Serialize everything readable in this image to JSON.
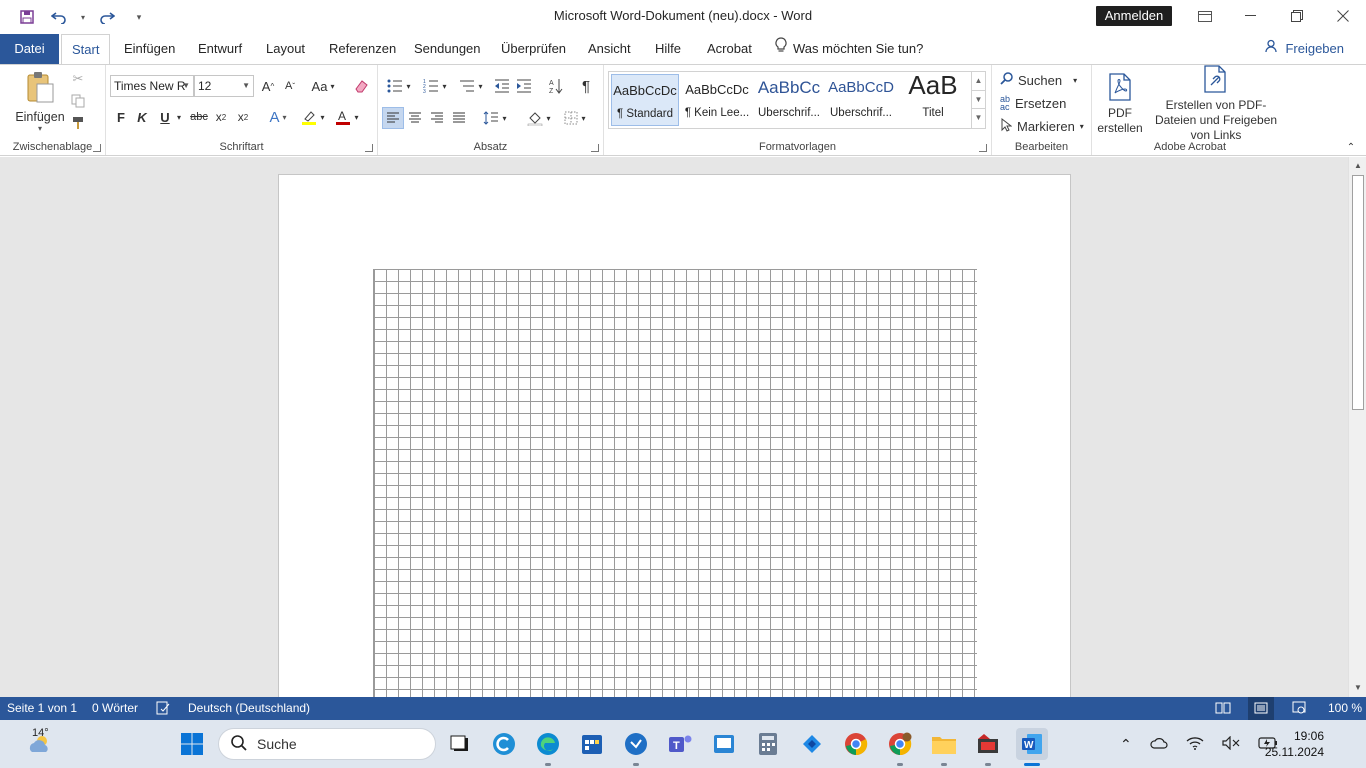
{
  "title_bar": {
    "document_title": "Microsoft Word-Dokument (neu).docx  -  Word",
    "signin_label": "Anmelden"
  },
  "tabs": {
    "file": "Datei",
    "items": [
      "Start",
      "Einfügen",
      "Entwurf",
      "Layout",
      "Referenzen",
      "Sendungen",
      "Überprüfen",
      "Ansicht",
      "Hilfe",
      "Acrobat"
    ],
    "active": "Start",
    "tell_me": "Was möchten Sie tun?",
    "share": "Freigeben"
  },
  "ribbon": {
    "clipboard": {
      "paste_label": "Einfügen",
      "group_label": "Zwischenablage"
    },
    "font": {
      "font_name": "Times New R",
      "font_size": "12",
      "group_label": "Schriftart",
      "bold": "F",
      "italic": "K",
      "underline": "U"
    },
    "paragraph": {
      "group_label": "Absatz"
    },
    "styles": {
      "group_label": "Formatvorlagen",
      "items": [
        {
          "sample": "AaBbCcDc",
          "name": "¶ Standard"
        },
        {
          "sample": "AaBbCcDc",
          "name": "¶ Kein Lee..."
        },
        {
          "sample": "AaBbCc",
          "name": "Überschrif..."
        },
        {
          "sample": "AaBbCcD",
          "name": "Überschrif..."
        },
        {
          "sample": "AaB",
          "name": "Titel"
        }
      ]
    },
    "editing": {
      "find": "Suchen",
      "replace": "Ersetzen",
      "select": "Markieren",
      "group_label": "Bearbeiten"
    },
    "acrobat": {
      "create_pdf": "PDF erstellen",
      "create_share": "Erstellen von PDF-Dateien und Freigeben von Links",
      "group_label": "Adobe Acrobat"
    }
  },
  "status_bar": {
    "page": "Seite 1 von 1",
    "words": "0 Wörter",
    "language": "Deutsch (Deutschland)",
    "zoom": "100 %"
  },
  "taskbar": {
    "weather": "14°",
    "search_placeholder": "Suche",
    "time": "19:06",
    "date": "25.11.2024"
  },
  "colors": {
    "accent": "#2b579a",
    "grid_line": "#9a9a9a"
  }
}
